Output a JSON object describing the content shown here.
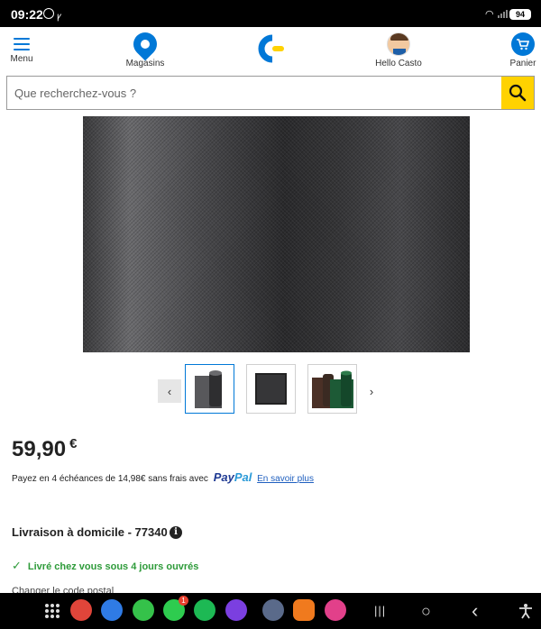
{
  "status_bar": {
    "time": "09:22",
    "battery": "94"
  },
  "header": {
    "menu_label": "Menu",
    "stores_label": "Magasins",
    "hello_label": "Hello Casto",
    "cart_label": "Panier",
    "logo_name": "castorama-logo",
    "accent_color": "#0078d7"
  },
  "search": {
    "placeholder": "Que recherchez-vous ?",
    "button_color": "#ffd200"
  },
  "product": {
    "price_main": "59,90",
    "price_currency": "€",
    "installments_text": "Payez en 4 échéances de 14,98€ sans frais avec",
    "paypal_pay": "Pay",
    "paypal_pal": "Pal",
    "learn_more": "En savoir plus"
  },
  "gallery": {
    "prev_icon": "‹",
    "next_icon": "›",
    "thumbnails": [
      "rolled-screen-grey",
      "screen-panel-dark",
      "rolled-screens-brown-green"
    ]
  },
  "delivery": {
    "title": "Livraison à domicile - 77340",
    "info_icon": "i",
    "status": "Livré chez vous sous 4 jours ouvrés",
    "change_zip": "Changer le code postal"
  },
  "system_nav": {
    "recents": "|||",
    "home": "○",
    "back": "‹",
    "badge_count": "1"
  }
}
